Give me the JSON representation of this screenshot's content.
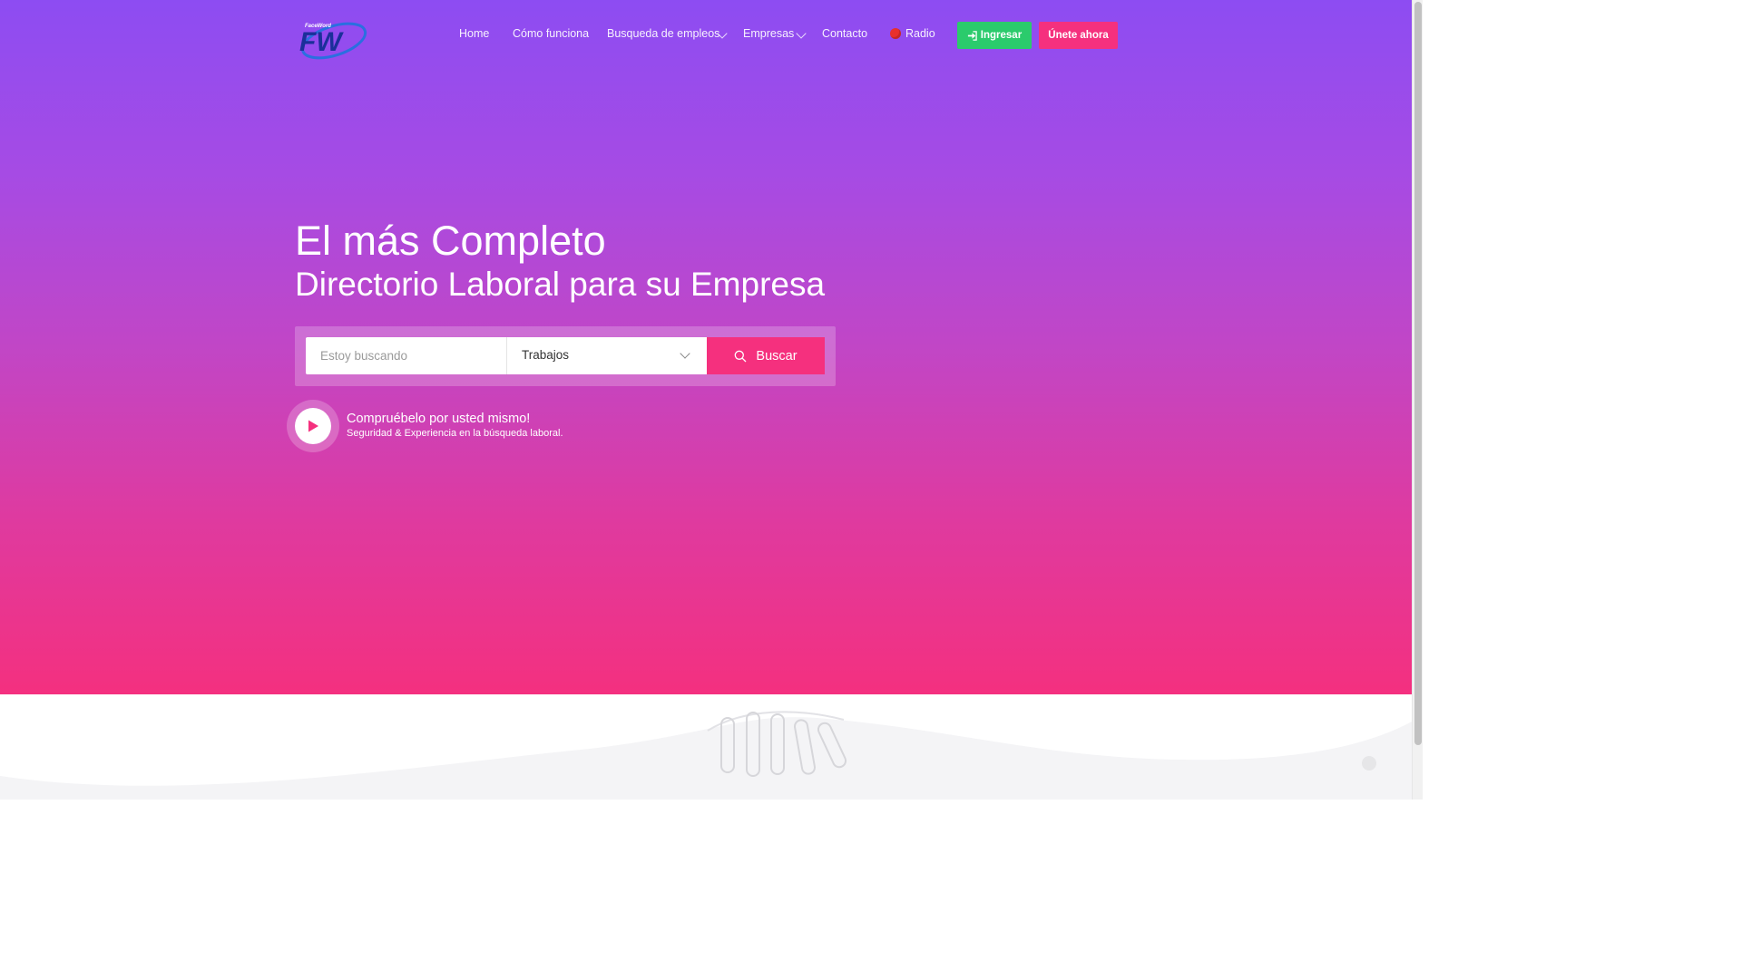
{
  "header": {
    "logo": {
      "text": "FaceWord",
      "mark": "FW"
    },
    "nav": [
      {
        "label": "Home",
        "has_dropdown": false
      },
      {
        "label": "Cómo funciona",
        "has_dropdown": false
      },
      {
        "label": "Busqueda de empleos",
        "has_dropdown": true
      },
      {
        "label": "Empresas",
        "has_dropdown": true
      },
      {
        "label": "Contacto",
        "has_dropdown": false
      },
      {
        "label": "Radio",
        "has_dropdown": false,
        "icon": "red-dot-icon"
      }
    ],
    "login_button": {
      "label": "Ingresar",
      "icon": "sign-in-icon",
      "color": "#2bcb6c"
    },
    "join_button": {
      "label": "Únete ahora",
      "color": "#f5307e"
    }
  },
  "hero": {
    "title_line1": "El más Completo",
    "title_line2": "Directorio Laboral para su Empresa",
    "gradient": [
      "#8d4cf2",
      "#f4307f"
    ],
    "search": {
      "placeholder": "Estoy buscando",
      "value": "",
      "category_selected": "Trabajos",
      "button_label": "Buscar",
      "button_icon": "search-icon"
    },
    "video": {
      "icon": "play-icon",
      "title": "Compruébelo por usted mismo!",
      "subtitle": "Seguridad & Experiencia en la búsqueda laboral."
    }
  }
}
